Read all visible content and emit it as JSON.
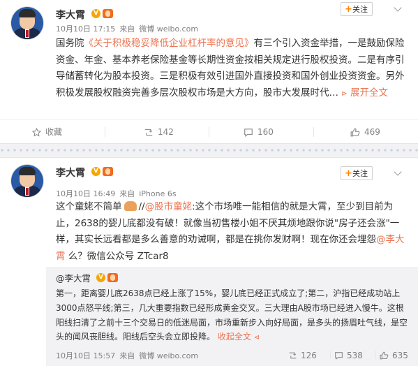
{
  "posts": [
    {
      "author": "李大霄",
      "v_mark": "V",
      "follow_label": "关注",
      "time": "10月10日 17:15",
      "source_prefix": "来自",
      "source": "微博 weibo.com",
      "text_a": "国务院",
      "text_link": "《关于积极稳妥降低企业杠杆率的意见》",
      "text_b": "有三个引入资金举措，一是鼓励保险资金、年金、基本养老保险基金等长期性资金按相关规定进行股权投资。二是有序引导储蓄转化为股本投资。三是积极有效引进国外直接投资和国外创业投资资金。另外积极发展股权融资完善多层次股权市场是大方向，股市大发展时代…",
      "expand_label": "展开全文",
      "actions": {
        "favorite": "收藏",
        "repost": "142",
        "comment": "160",
        "like": "469"
      }
    },
    {
      "author": "李大霄",
      "v_mark": "V",
      "follow_label": "关注",
      "time": "10月10日 16:49",
      "source_prefix": "来自",
      "source": "iPhone 6s",
      "text_a": "这个童姥不简单",
      "text_b": "//",
      "mention_1": "@股市童姥",
      "text_c": ":这个市场唯一能相信的就是大霄，至少到目前为止，2638的婴儿底都没有破！就像当初售楼小姐不厌其烦地跟你说\"房子还会涨\"一样，其实长远看都是多么善意的劝诫啊，都是在挑你发财啊！现在你还会埋怨",
      "mention_2": "@李大霄",
      "text_d": " 么？微信公众号 ZTcar8",
      "quote": {
        "author": "@李大霄",
        "v_mark": "V",
        "text": "第一，距离婴儿底2638点已经上涨了15%，婴儿底已经正式成立了;第二，沪指已经成功站上3000点怒平线;第三，几大重要指数已经形成黄金交叉。三大理由A股市场已经进入慢牛。这根阳线扫清了之前十三个交易日的低迷局面，市场重新步入向好局面，是多头的扬眉吐气线，是空头的闻风丧胆线。阳线后空头会立即投降。",
        "expand_label": "收起全文",
        "time": "10月10日 15:57",
        "source_prefix": "来自",
        "source": "微博 weibo.com",
        "repost": "126",
        "comment": "538",
        "like": "635"
      }
    }
  ],
  "colors": {
    "accent": "#eb7350",
    "follow_plus": "#ff8200",
    "vip": "#f7a500",
    "muted": "#808080"
  }
}
